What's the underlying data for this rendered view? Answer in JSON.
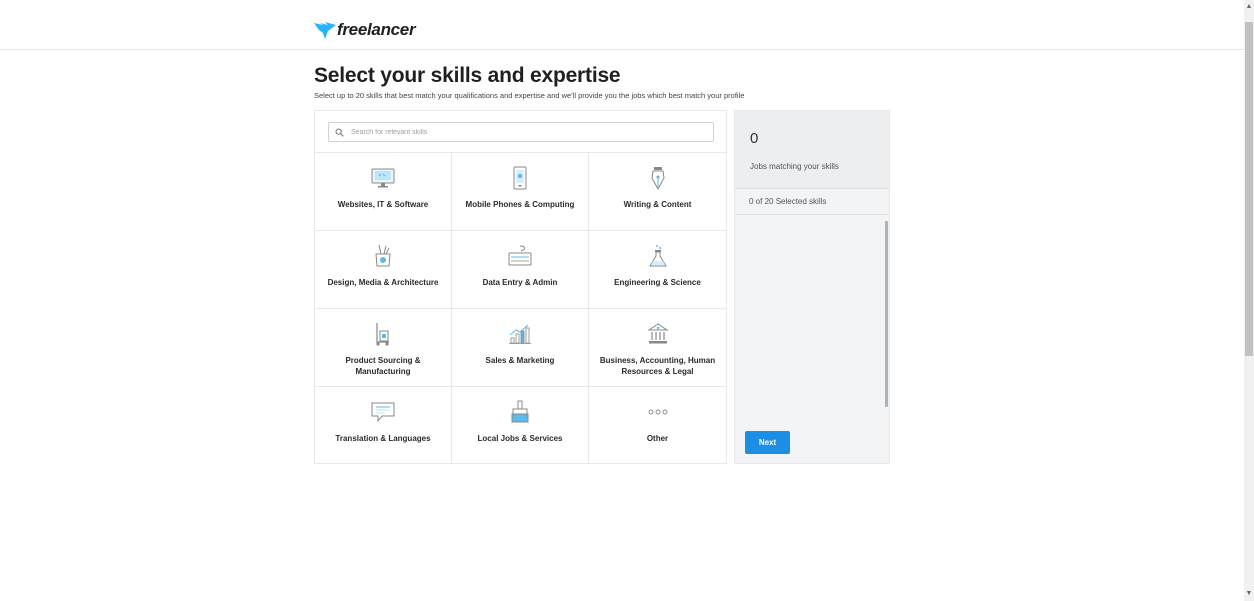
{
  "brand": {
    "name": "freelancer",
    "accent": "#29b2fe"
  },
  "header": {
    "title": "Select your skills and expertise",
    "subtitle": "Select up to 20 skills that best match your qualifications and expertise and we'll provide you the jobs which best match your profile"
  },
  "search": {
    "placeholder": "Search for relevant skills",
    "value": ""
  },
  "categories": [
    {
      "label": "Websites, IT & Software",
      "icon": "monitor-icon"
    },
    {
      "label": "Mobile Phones & Computing",
      "icon": "mobile-phone-icon"
    },
    {
      "label": "Writing & Content",
      "icon": "pen-nib-icon"
    },
    {
      "label": "Design, Media & Architecture",
      "icon": "design-tools-icon"
    },
    {
      "label": "Data Entry & Admin",
      "icon": "keyboard-icon"
    },
    {
      "label": "Engineering & Science",
      "icon": "flask-icon"
    },
    {
      "label": "Product Sourcing & Manufacturing",
      "icon": "hand-truck-icon"
    },
    {
      "label": "Sales & Marketing",
      "icon": "growth-chart-icon"
    },
    {
      "label": "Business, Accounting, Human Resources & Legal",
      "icon": "bank-icon"
    },
    {
      "label": "Translation & Languages",
      "icon": "speech-bubble-icon"
    },
    {
      "label": "Local Jobs & Services",
      "icon": "paint-brush-icon"
    },
    {
      "label": "Other",
      "icon": "more-dots-icon"
    }
  ],
  "sidebar": {
    "job_count": "0",
    "jobs_label": "Jobs matching your skills",
    "selected_label": "0 of 20 Selected skills",
    "next_label": "Next"
  },
  "colors": {
    "primary_button": "#1d8ee6",
    "icon_blue": "#5fb8ea"
  }
}
